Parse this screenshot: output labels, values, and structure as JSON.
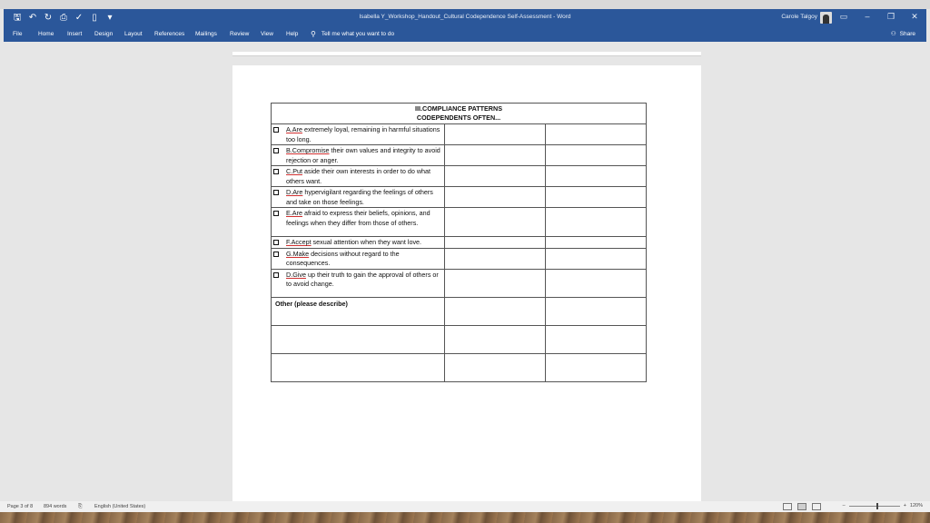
{
  "window": {
    "title": "Isabella Y_Workshop_Handout_Cultural Codependence Self-Assessment - Word",
    "user": "Carole Talgoy",
    "controls": {
      "ribbon_display": "▭",
      "minimize": "–",
      "restore": "❐",
      "close": "✕"
    }
  },
  "qat": {
    "save": "🖫",
    "undo": "↶",
    "redo": "↻",
    "print": "⎙",
    "check": "✓",
    "new": "▯",
    "more": "▾"
  },
  "menu": {
    "items": [
      "File",
      "Home",
      "Insert",
      "Design",
      "Layout",
      "References",
      "Mailings",
      "Review",
      "View",
      "Help"
    ],
    "tell_me": "Tell me what you want to do",
    "share": "Share"
  },
  "table": {
    "title_line1": "III.COMPLIANCE PATTERNS",
    "title_line2": "CODEPENDENTS OFTEN...",
    "items": [
      {
        "lead": "A.Are",
        "text": " extremely loyal, remaining in harmful situations too long."
      },
      {
        "lead": "B.Compromise",
        "text": " their own values and integrity to avoid rejection or anger."
      },
      {
        "lead": "C.Put",
        "text": " aside their own interests in order to do what others want."
      },
      {
        "lead": "D.Are",
        "text": " hypervigilant regarding the feelings of others and take on those feelings."
      },
      {
        "lead": "E.Are",
        "text": " afraid to express their beliefs, opinions, and feelings when they differ from those of others."
      },
      {
        "lead": "F.Accept",
        "text": " sexual attention when they want love."
      },
      {
        "lead": "G.Make",
        "text": " decisions without regard to the consequences."
      },
      {
        "lead": "D.Give",
        "text": " up their truth to gain the approval of others or to avoid change."
      }
    ],
    "other_label": "Other (please describe)"
  },
  "status": {
    "page": "Page 3 of 8",
    "words": "894 words",
    "language": "English (United States)",
    "zoom": "120%"
  }
}
